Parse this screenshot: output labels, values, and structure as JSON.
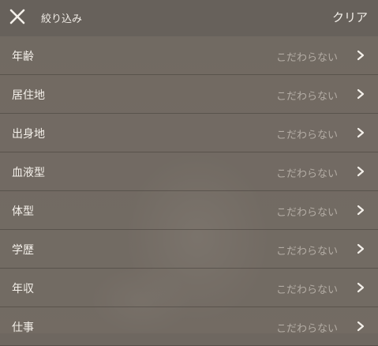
{
  "header": {
    "title": "絞り込み",
    "clear_label": "クリア"
  },
  "filters": [
    {
      "label": "年齢",
      "value": "こだわらない"
    },
    {
      "label": "居住地",
      "value": "こだわらない"
    },
    {
      "label": "出身地",
      "value": "こだわらない"
    },
    {
      "label": "血液型",
      "value": "こだわらない"
    },
    {
      "label": "体型",
      "value": "こだわらない"
    },
    {
      "label": "学歴",
      "value": "こだわらない"
    },
    {
      "label": "年収",
      "value": "こだわらない"
    },
    {
      "label": "仕事",
      "value": "こだわらない"
    }
  ],
  "icons": {
    "close": "close-icon",
    "chevron": "chevron-right-icon"
  },
  "colors": {
    "overlay": "#736c64",
    "header_bg": "#67615b",
    "text": "#f4f0ea",
    "value_text": "#b3aca4"
  }
}
